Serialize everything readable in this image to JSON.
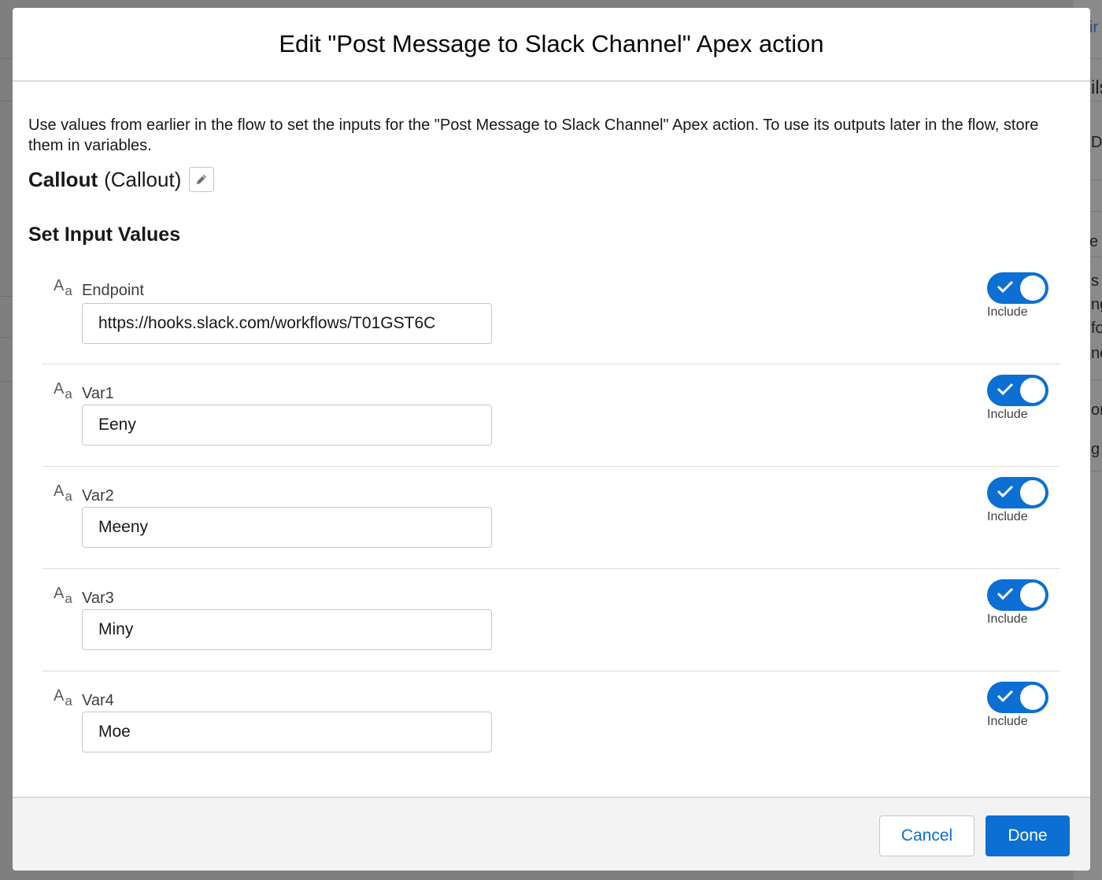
{
  "background_page": {
    "fragments": [
      "ir",
      "ils",
      "De",
      "e I",
      "s",
      "ng",
      "fo",
      "ne",
      "on",
      "g i"
    ]
  },
  "modal": {
    "title": "Edit \"Post Message to Slack Channel\" Apex action",
    "intro": "Use values from earlier in the flow to set the inputs for the \"Post Message to Slack Channel\" Apex action. To use its outputs later in the flow, store them in variables.",
    "callout": {
      "name": "Callout",
      "type": "(Callout)",
      "edit_icon": "pencil-icon"
    },
    "section_title": "Set Input Values",
    "type_icon": {
      "upper": "A",
      "lower": "a"
    },
    "params": [
      {
        "label": "Endpoint",
        "value": "https://hooks.slack.com/workflows/T01GST6C",
        "include": true,
        "include_label": "Include"
      },
      {
        "label": "Var1",
        "value": "Eeny",
        "include": true,
        "include_label": "Include"
      },
      {
        "label": "Var2",
        "value": "Meeny",
        "include": true,
        "include_label": "Include"
      },
      {
        "label": "Var3",
        "value": "Miny",
        "include": true,
        "include_label": "Include"
      },
      {
        "label": "Var4",
        "value": "Moe",
        "include": true,
        "include_label": "Include"
      }
    ],
    "footer": {
      "cancel_label": "Cancel",
      "done_label": "Done"
    }
  },
  "colors": {
    "brand": "#0b6fd3",
    "overlay": "#7f7f7f",
    "border": "#c9c7c5"
  }
}
